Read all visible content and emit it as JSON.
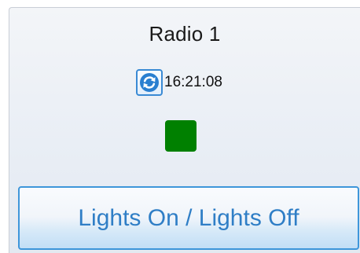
{
  "widget": {
    "title": "Radio 1",
    "time": "16:21:08",
    "status_color": "#008000",
    "refresh_icon": "refresh-icon",
    "toggle_label": "Lights On / Lights Off",
    "accent_color": "#3e96da"
  }
}
